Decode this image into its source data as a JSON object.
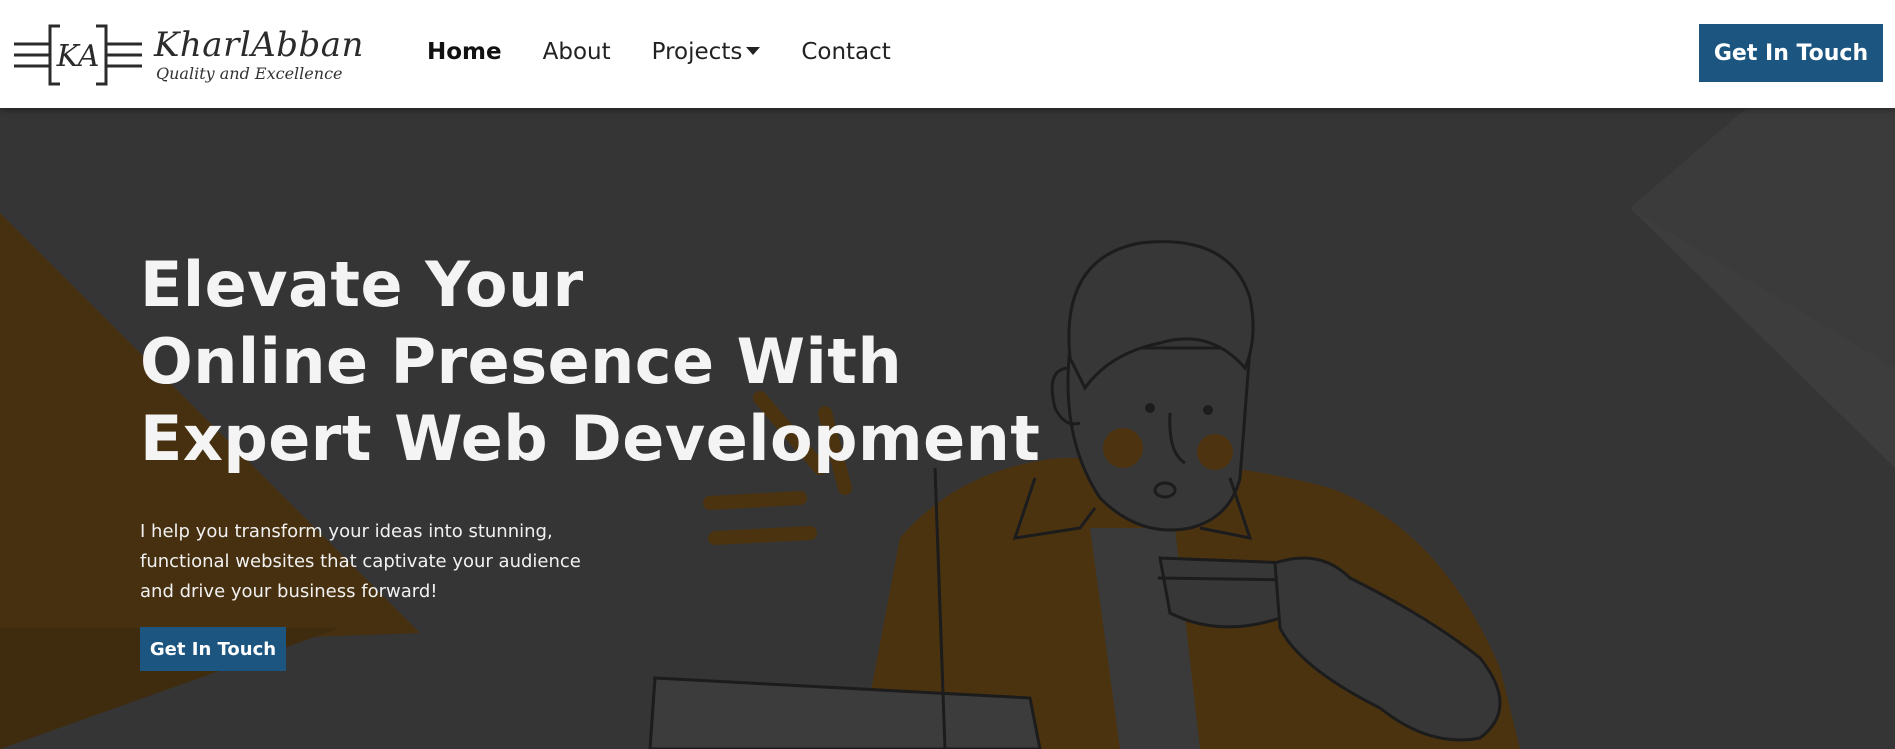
{
  "brand": {
    "name": "KharlAbban",
    "tagline": "Quality and Excellence",
    "monogram": "KA"
  },
  "nav": {
    "items": [
      {
        "label": "Home",
        "active": true
      },
      {
        "label": "About",
        "active": false
      },
      {
        "label": "Projects",
        "active": false,
        "has_dropdown": true
      },
      {
        "label": "Contact",
        "active": false
      }
    ],
    "cta_label": "Get In Touch"
  },
  "hero": {
    "title_lines": [
      "Elevate Your",
      "Online Presence With",
      "Expert Web Development"
    ],
    "subtitle": "I help you transform your ideas into stunning, functional websites that captivate your audience and drive your business forward!",
    "cta_label": "Get In Touch",
    "illustration": "man-with-coffee-and-laptop"
  },
  "colors": {
    "accent": "#1b5580",
    "hero_bg": "#353535",
    "hero_orange": "#4a3114"
  }
}
